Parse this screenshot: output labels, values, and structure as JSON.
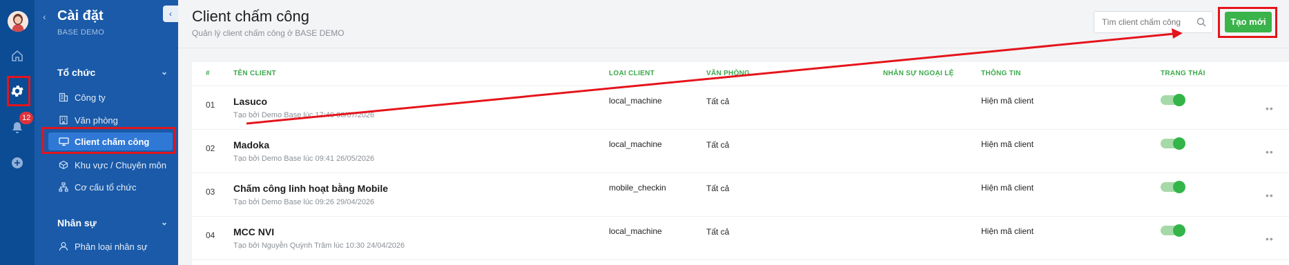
{
  "rail": {
    "notification_count": "12",
    "icons": [
      "avatar",
      "home-icon",
      "gear-icon",
      "bell-icon",
      "plus-circle-icon"
    ]
  },
  "sidebar": {
    "title": "Cài đặt",
    "subtitle": "BASE DEMO",
    "sections": [
      {
        "label": "Tổ chức",
        "items": [
          {
            "label": "Công ty",
            "icon": "building-icon"
          },
          {
            "label": "Văn phòng",
            "icon": "office-icon"
          },
          {
            "label": "Client chấm công",
            "icon": "monitor-icon",
            "active": true
          },
          {
            "label": "Khu vực / Chuyên môn",
            "icon": "cube-icon"
          },
          {
            "label": "Cơ cấu tổ chức",
            "icon": "org-chart-icon"
          }
        ]
      },
      {
        "label": "Nhân sự",
        "items": [
          {
            "label": "Phân loại nhân sự",
            "icon": "person-icon"
          }
        ]
      }
    ]
  },
  "header": {
    "title": "Client chấm công",
    "subtitle": "Quản lý client chấm công ở BASE DEMO",
    "search_placeholder": "Tìm client chấm công",
    "new_button": "Tạo mới"
  },
  "table": {
    "columns": [
      "#",
      "TÊN CLIENT",
      "LOẠI CLIENT",
      "VĂN PHÒNG",
      "NHÂN SỰ NGOẠI LỆ",
      "THÔNG TIN",
      "TRẠNG THÁI"
    ],
    "rows": [
      {
        "no": "01",
        "name": "Lasuco",
        "meta": "Tạo bởi Demo Base lúc 17:40 06/07/2026",
        "type": "local_machine",
        "office": "Tất cả",
        "info": "Hiện mã client",
        "enabled": true
      },
      {
        "no": "02",
        "name": "Madoka",
        "meta": "Tạo bởi Demo Base lúc 09:41 26/05/2026",
        "type": "local_machine",
        "office": "Tất cả",
        "info": "Hiện mã client",
        "enabled": true
      },
      {
        "no": "03",
        "name": "Chấm công linh hoạt bằng Mobile",
        "meta": "Tạo bởi Demo Base lúc 09:26 29/04/2026",
        "type": "mobile_checkin",
        "office": "Tất cả",
        "info": "Hiện mã client",
        "enabled": true
      },
      {
        "no": "04",
        "name": "MCC NVI",
        "meta": "Tạo bởi Nguyễn Quỳnh Trâm lúc 10:30 24/04/2026",
        "type": "local_machine",
        "office": "Tất cả",
        "info": "Hiện mã client",
        "enabled": true
      }
    ],
    "more_glyph": "••"
  },
  "colors": {
    "rail_bg": "#0c4c94",
    "sidebar_bg": "#1a5aa8",
    "active_item": "#2f78d6",
    "accent_green": "#3ab34a",
    "annotation_red": "#e5141b"
  }
}
